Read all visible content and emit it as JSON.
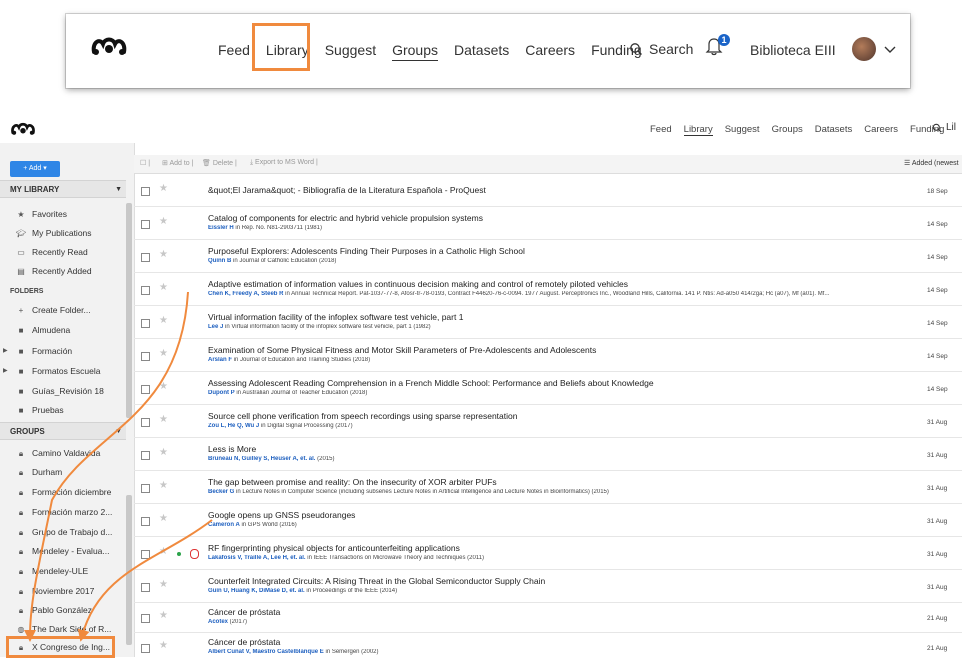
{
  "zoomed_nav": {
    "items": [
      "Feed",
      "Library",
      "Suggest",
      "Groups",
      "Datasets",
      "Careers",
      "Funding"
    ],
    "active": "Groups",
    "search_label": "Search",
    "notification_count": "1",
    "user_name": "Biblioteca EIII"
  },
  "header": {
    "nav": [
      "Feed",
      "Library",
      "Suggest",
      "Groups",
      "Datasets",
      "Careers",
      "Funding"
    ],
    "search_label": "Lil"
  },
  "sidebar": {
    "add_label": "+ Add ▾",
    "my_library_title": "MY LIBRARY",
    "library_items": [
      {
        "label": "Favorites",
        "icon": "star-icon"
      },
      {
        "label": "My Publications",
        "icon": "graduation-cap-icon"
      },
      {
        "label": "Recently Read",
        "icon": "book-icon"
      },
      {
        "label": "Recently Added",
        "icon": "document-icon"
      }
    ],
    "folders_title": "FOLDERS",
    "folder_items": [
      {
        "label": "Create Folder...",
        "icon": "plus-icon"
      },
      {
        "label": "Almudena",
        "icon": "folder-icon"
      },
      {
        "label": "Formación",
        "icon": "folder-icon"
      },
      {
        "label": "Formatos Escuela",
        "icon": "folder-icon"
      },
      {
        "label": "Guías_Revisión 18",
        "icon": "folder-icon"
      },
      {
        "label": "Pruebas",
        "icon": "folder-icon"
      }
    ],
    "groups_title": "GROUPS",
    "group_items": [
      {
        "label": "Camino Valdavida",
        "icon": "lock-icon"
      },
      {
        "label": "Durham",
        "icon": "lock-icon"
      },
      {
        "label": "Formación diciembre",
        "icon": "lock-icon"
      },
      {
        "label": "Formación marzo 2...",
        "icon": "lock-icon"
      },
      {
        "label": "Grupo de Trabajo d...",
        "icon": "lock-icon"
      },
      {
        "label": "Mendeley - Evalua...",
        "icon": "lock-icon"
      },
      {
        "label": "Mendeley-ULE",
        "icon": "lock-icon"
      },
      {
        "label": "Noviembre 2017",
        "icon": "lock-icon"
      },
      {
        "label": "Pablo González",
        "icon": "lock-icon"
      },
      {
        "label": "The Dark Side of R...",
        "icon": "globe-icon"
      },
      {
        "label": "X Congreso de Ing...",
        "icon": "lock-icon"
      }
    ]
  },
  "toolbar": {
    "add_to": "Add to",
    "delete": "Delete",
    "export": "Export to MS Word",
    "sort": "Added (newest"
  },
  "documents": [
    {
      "title": "&quot;El Jarama&quot; - Bibliografía de la Literatura Española - ProQuest",
      "authors": "",
      "meta": "",
      "date": "18 Sep"
    },
    {
      "title": "Catalog of components for electric and hybrid vehicle propulsion systems",
      "authors": "Eissler H",
      "meta": " in Rep. No. N81-2903711 (1981)",
      "date": "14 Sep"
    },
    {
      "title": "Purposeful Explorers: Adolescents Finding Their Purposes in a Catholic High School",
      "authors": "Quinn B",
      "meta": " in Journal of Catholic Education (2018)",
      "date": "14 Sep"
    },
    {
      "title": "Adaptive estimation of information values in continuous decision making and control of remotely piloted vehicles",
      "authors": "Chen K, Freedy A, Steeb R",
      "meta": " in Annual Technical Report. Pat-1037-77-8, Afosr-tr-78-0193, Contract F44620-76-c-0094. 1977 August. Perceptronics Inc., Woodland Hills, California. 141 P. Ntis: Ad-a050 414/2ga; Hc (a07), Mf (a01). Mf...",
      "date": "14 Sep"
    },
    {
      "title": "Virtual information facility of the infoplex software test vehicle, part 1",
      "authors": "Lee J",
      "meta": " in Virtual information facility of the infoplex software test vehicle, part 1 (1982)",
      "date": "14 Sep"
    },
    {
      "title": "Examination of Some Physical Fitness and Motor Skill Parameters of Pre-Adolescents and Adolescents",
      "authors": "Arslan F",
      "meta": " in Journal of Education and Training Studies (2018)",
      "date": "14 Sep"
    },
    {
      "title": "Assessing Adolescent Reading Comprehension in a French Middle School: Performance and Beliefs about Knowledge",
      "authors": "Dupont P",
      "meta": " in Australian Journal of Teacher Education (2018)",
      "date": "14 Sep"
    },
    {
      "title": "Source cell phone verification from speech recordings using sparse representation",
      "authors": "Zou L, He Q, Wu J",
      "meta": " in Digital Signal Processing (2017)",
      "date": "31 Aug"
    },
    {
      "title": "Less is More",
      "authors": "Bruneau N, Guilley S, Heuser A, et. al.",
      "meta": " (2015)",
      "date": "31 Aug"
    },
    {
      "title": "The gap between promise and reality: On the insecurity of XOR arbiter PUFs",
      "authors": "Becker G",
      "meta": " in Lecture Notes in Computer Science (including subseries Lecture Notes in Artificial Intelligence and Lecture Notes in Bioinformatics) (2015)",
      "date": "31 Aug"
    },
    {
      "title": "Google opens up GNSS pseudoranges",
      "authors": "Cameron A",
      "meta": " in GPS World (2016)",
      "date": "31 Aug"
    },
    {
      "title": "RF fingerprinting physical objects for anticounterfeiting applications",
      "authors": "Lakafosis V, Traille A, Lee H, et. al.",
      "meta": " in IEEE Transactions on Microwave Theory and Techniques (2011)",
      "date": "31 Aug"
    },
    {
      "title": "Counterfeit Integrated Circuits: A Rising Threat in the Global Semiconductor Supply Chain",
      "authors": "Guin U, Huang K, DiMase D, et. al.",
      "meta": " in Proceedings of the IEEE (2014)",
      "date": "31 Aug"
    },
    {
      "title": "Cáncer de próstata",
      "authors": "Acotex",
      "meta": " (2017)",
      "date": "21 Aug"
    },
    {
      "title": "Cáncer de próstata",
      "authors": "Albert Cuñat V, Maestro Castelblanque E",
      "meta": " in Semergen (2002)",
      "date": "21 Aug"
    }
  ],
  "colors": {
    "accent": "#2f86e6",
    "highlight": "#f08a3e",
    "author_link": "#1d5fbf"
  }
}
